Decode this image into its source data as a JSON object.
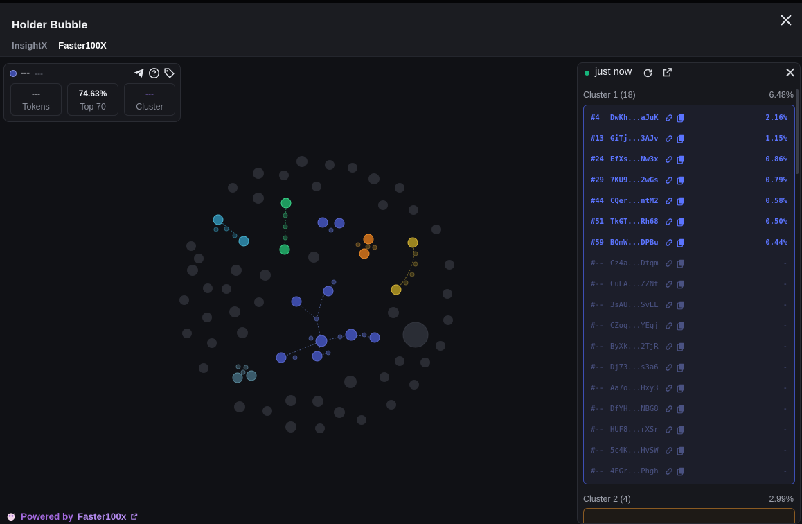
{
  "header": {
    "title": "Holder Bubble",
    "tabs": [
      "InsightX",
      "Faster100X"
    ],
    "active_tab": "Faster100X"
  },
  "info": {
    "name": "---",
    "sub": "---",
    "stats": [
      {
        "value": "---",
        "label": "Tokens"
      },
      {
        "value": "74.63%",
        "label": "Top 70"
      },
      {
        "value": "---",
        "label": "Cluster"
      }
    ]
  },
  "footer": {
    "prefix": "Powered by",
    "brand": "Faster100x"
  },
  "panel": {
    "status": "just now",
    "clusters": [
      {
        "label": "Cluster 1 (18)",
        "percent": "6.48%",
        "rows": [
          {
            "rank": "#4",
            "addr": "DwKh...aJuK",
            "pct": "2.16%",
            "on": true
          },
          {
            "rank": "#13",
            "addr": "GiTj...3AJv",
            "pct": "1.15%",
            "on": true
          },
          {
            "rank": "#24",
            "addr": "EfXs...Nw3x",
            "pct": "0.86%",
            "on": true
          },
          {
            "rank": "#29",
            "addr": "7KU9...2wGs",
            "pct": "0.79%",
            "on": true
          },
          {
            "rank": "#44",
            "addr": "CQer...ntM2",
            "pct": "0.58%",
            "on": true
          },
          {
            "rank": "#51",
            "addr": "TkGT...Rh68",
            "pct": "0.50%",
            "on": true
          },
          {
            "rank": "#59",
            "addr": "BQmW...DPBu",
            "pct": "0.44%",
            "on": true
          },
          {
            "rank": "#--",
            "addr": "Cz4a...Dtqm",
            "pct": "-",
            "on": false
          },
          {
            "rank": "#--",
            "addr": "CuLA...ZZNt",
            "pct": "-",
            "on": false
          },
          {
            "rank": "#--",
            "addr": "3sAU...SvLL",
            "pct": "-",
            "on": false
          },
          {
            "rank": "#--",
            "addr": "CZog...YEgj",
            "pct": "-",
            "on": false
          },
          {
            "rank": "#--",
            "addr": "ByXk...2TjR",
            "pct": "-",
            "on": false
          },
          {
            "rank": "#--",
            "addr": "Dj73...s3a6",
            "pct": "-",
            "on": false
          },
          {
            "rank": "#--",
            "addr": "Aa7o...Hxy3",
            "pct": "-",
            "on": false
          },
          {
            "rank": "#--",
            "addr": "DfYH...NBG8",
            "pct": "-",
            "on": false
          },
          {
            "rank": "#--",
            "addr": "HUF8...rXSr",
            "pct": "-",
            "on": false
          },
          {
            "rank": "#--",
            "addr": "5c4K...HvSW",
            "pct": "-",
            "on": false
          },
          {
            "rank": "#--",
            "addr": "4EGr...Phgh",
            "pct": "-",
            "on": false
          }
        ]
      },
      {
        "label": "Cluster 2 (4)",
        "percent": "2.99%"
      }
    ]
  },
  "colors": {
    "accent": "#5b74ff",
    "live": "#17b57c",
    "brand": "#a56ae0"
  }
}
